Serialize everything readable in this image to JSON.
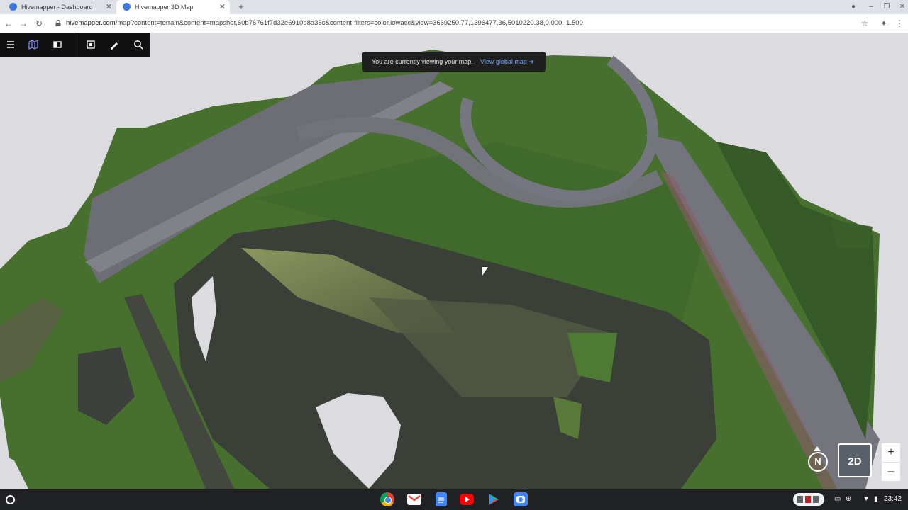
{
  "browser": {
    "tabs": [
      {
        "title": "Hivemapper - Dashboard",
        "active": false
      },
      {
        "title": "Hivemapper 3D Map",
        "active": true
      }
    ],
    "new_tab": "+",
    "url_host": "hivemapper.com",
    "url_path": "/map?content=terrain&content=mapshot,60b76761f7d32e6910b8a35c&content-filters=color,lowacc&view=3669250.77,1396477.36,5010220.38,0.000,-1.500",
    "window_controls": [
      "–",
      "❐",
      "✕"
    ]
  },
  "toolbar": {
    "icons": [
      "menu-icon",
      "map-icon",
      "layers-toggle-icon",
      "mapshot-icon",
      "draw-pencil-icon",
      "search-icon"
    ]
  },
  "notice": {
    "message": "You are currently viewing your map.",
    "link_label": "View global map",
    "link_arrow": "➔"
  },
  "map_controls": {
    "compass_label": "N",
    "view_mode_label": "2D",
    "zoom_in": "+",
    "zoom_out": "–"
  },
  "taskbar": {
    "apps": [
      "chrome-icon",
      "gmail-icon",
      "docs-icon",
      "youtube-icon",
      "play-store-icon",
      "camera-icon"
    ],
    "time": "23:42"
  },
  "colors": {
    "toolbar_bg": "#111111",
    "toast_bg": "#1f1f1f",
    "link": "#6fa8ff",
    "grass": "#3f6b2e",
    "road": "#6e6e76",
    "water": "#3a3f38"
  }
}
